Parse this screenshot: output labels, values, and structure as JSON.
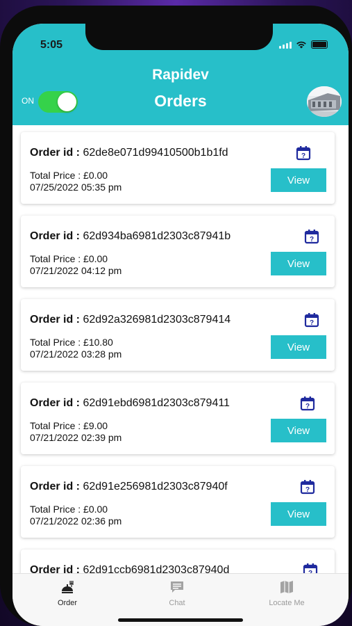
{
  "status_bar": {
    "time": "5:05"
  },
  "header": {
    "app_name": "Rapidev",
    "page_title": "Orders",
    "toggle_label": "ON",
    "toggle_state": "on"
  },
  "orders": [
    {
      "label": "Order id :",
      "id": "62de8e071d99410500b1b1fd",
      "price": "Total Price : £0.00",
      "date": "07/25/2022 05:35 pm",
      "view_label": "View"
    },
    {
      "label": "Order id :",
      "id": "62d934ba6981d2303c87941b",
      "price": "Total Price : £0.00",
      "date": "07/21/2022 04:12 pm",
      "view_label": "View"
    },
    {
      "label": "Order id :",
      "id": "62d92a326981d2303c879414",
      "price": "Total Price : £10.80",
      "date": "07/21/2022 03:28 pm",
      "view_label": "View"
    },
    {
      "label": "Order id :",
      "id": "62d91ebd6981d2303c879411",
      "price": "Total Price : £9.00",
      "date": "07/21/2022 02:39 pm",
      "view_label": "View"
    },
    {
      "label": "Order id :",
      "id": "62d91e256981d2303c87940f",
      "price": "Total Price : £0.00",
      "date": "07/21/2022 02:36 pm",
      "view_label": "View"
    },
    {
      "label": "Order id :",
      "id": "62d91ccb6981d2303c87940d",
      "price": "",
      "date": "",
      "view_label": ""
    }
  ],
  "tabbar": {
    "items": [
      {
        "label": "Order",
        "icon": "food-order-icon",
        "active": true
      },
      {
        "label": "Chat",
        "icon": "chat-icon",
        "active": false
      },
      {
        "label": "Locate Me",
        "icon": "map-icon",
        "active": false
      }
    ]
  },
  "colors": {
    "accent": "#27bfc9",
    "calendar_icon": "#1f2a9e",
    "toggle_on": "#35d24a"
  }
}
